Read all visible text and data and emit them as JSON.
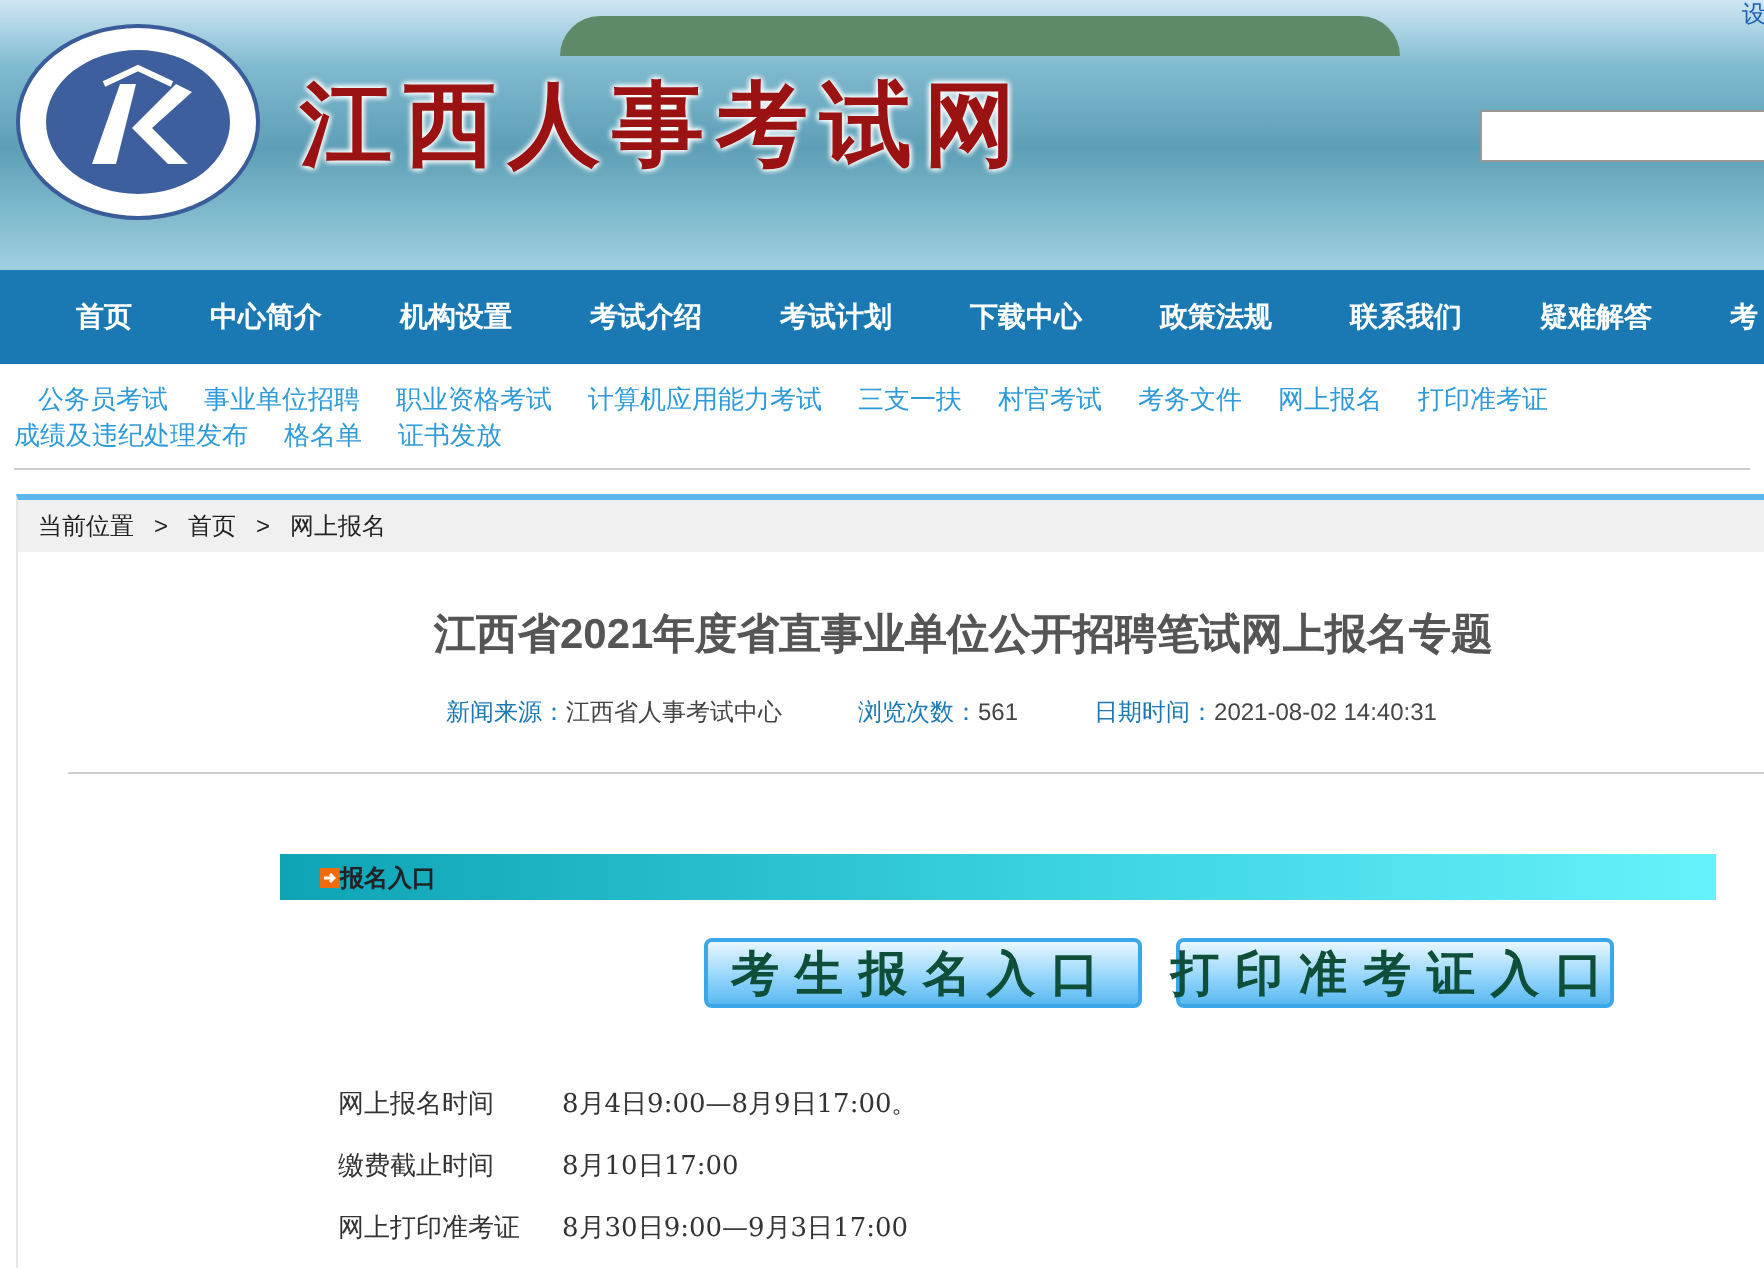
{
  "header": {
    "site_title": "江西人事考试网",
    "corner_link": "设"
  },
  "nav": [
    "首页",
    "中心简介",
    "机构设置",
    "考试介绍",
    "考试计划",
    "下载中心",
    "政策法规",
    "联系我们",
    "疑难解答",
    "考"
  ],
  "sub_nav": [
    "公务员考试",
    "事业单位招聘",
    "职业资格考试",
    "计算机应用能力考试",
    "三支一扶",
    "村官考试",
    "考务文件",
    "网上报名",
    "打印准考证",
    "成绩及违纪处理发布",
    "格名单",
    "证书发放"
  ],
  "breadcrumb": {
    "label": "当前位置",
    "items": [
      "首页",
      "网上报名"
    ],
    "separator": ">"
  },
  "article": {
    "title": "江西省2021年度省直事业单位公开招聘笔试网上报名专题",
    "meta": [
      {
        "label": "新闻来源：",
        "value": "江西省人事考试中心"
      },
      {
        "label": "浏览次数：",
        "value": "561"
      },
      {
        "label": "日期时间：",
        "value": "2021-08-02 14:40:31"
      }
    ]
  },
  "section": {
    "title": "报名入口"
  },
  "entry_buttons": [
    "考生报名入口",
    "打印准考证入口"
  ],
  "schedule": [
    {
      "label": "网上报名时间",
      "value": "8月4日9:00—8月9日17:00。"
    },
    {
      "label": "缴费截止时间",
      "value": "8月10日17:00"
    },
    {
      "label": "网上打印准考证",
      "value": "8月30日9:00—9月3日17:00"
    }
  ]
}
